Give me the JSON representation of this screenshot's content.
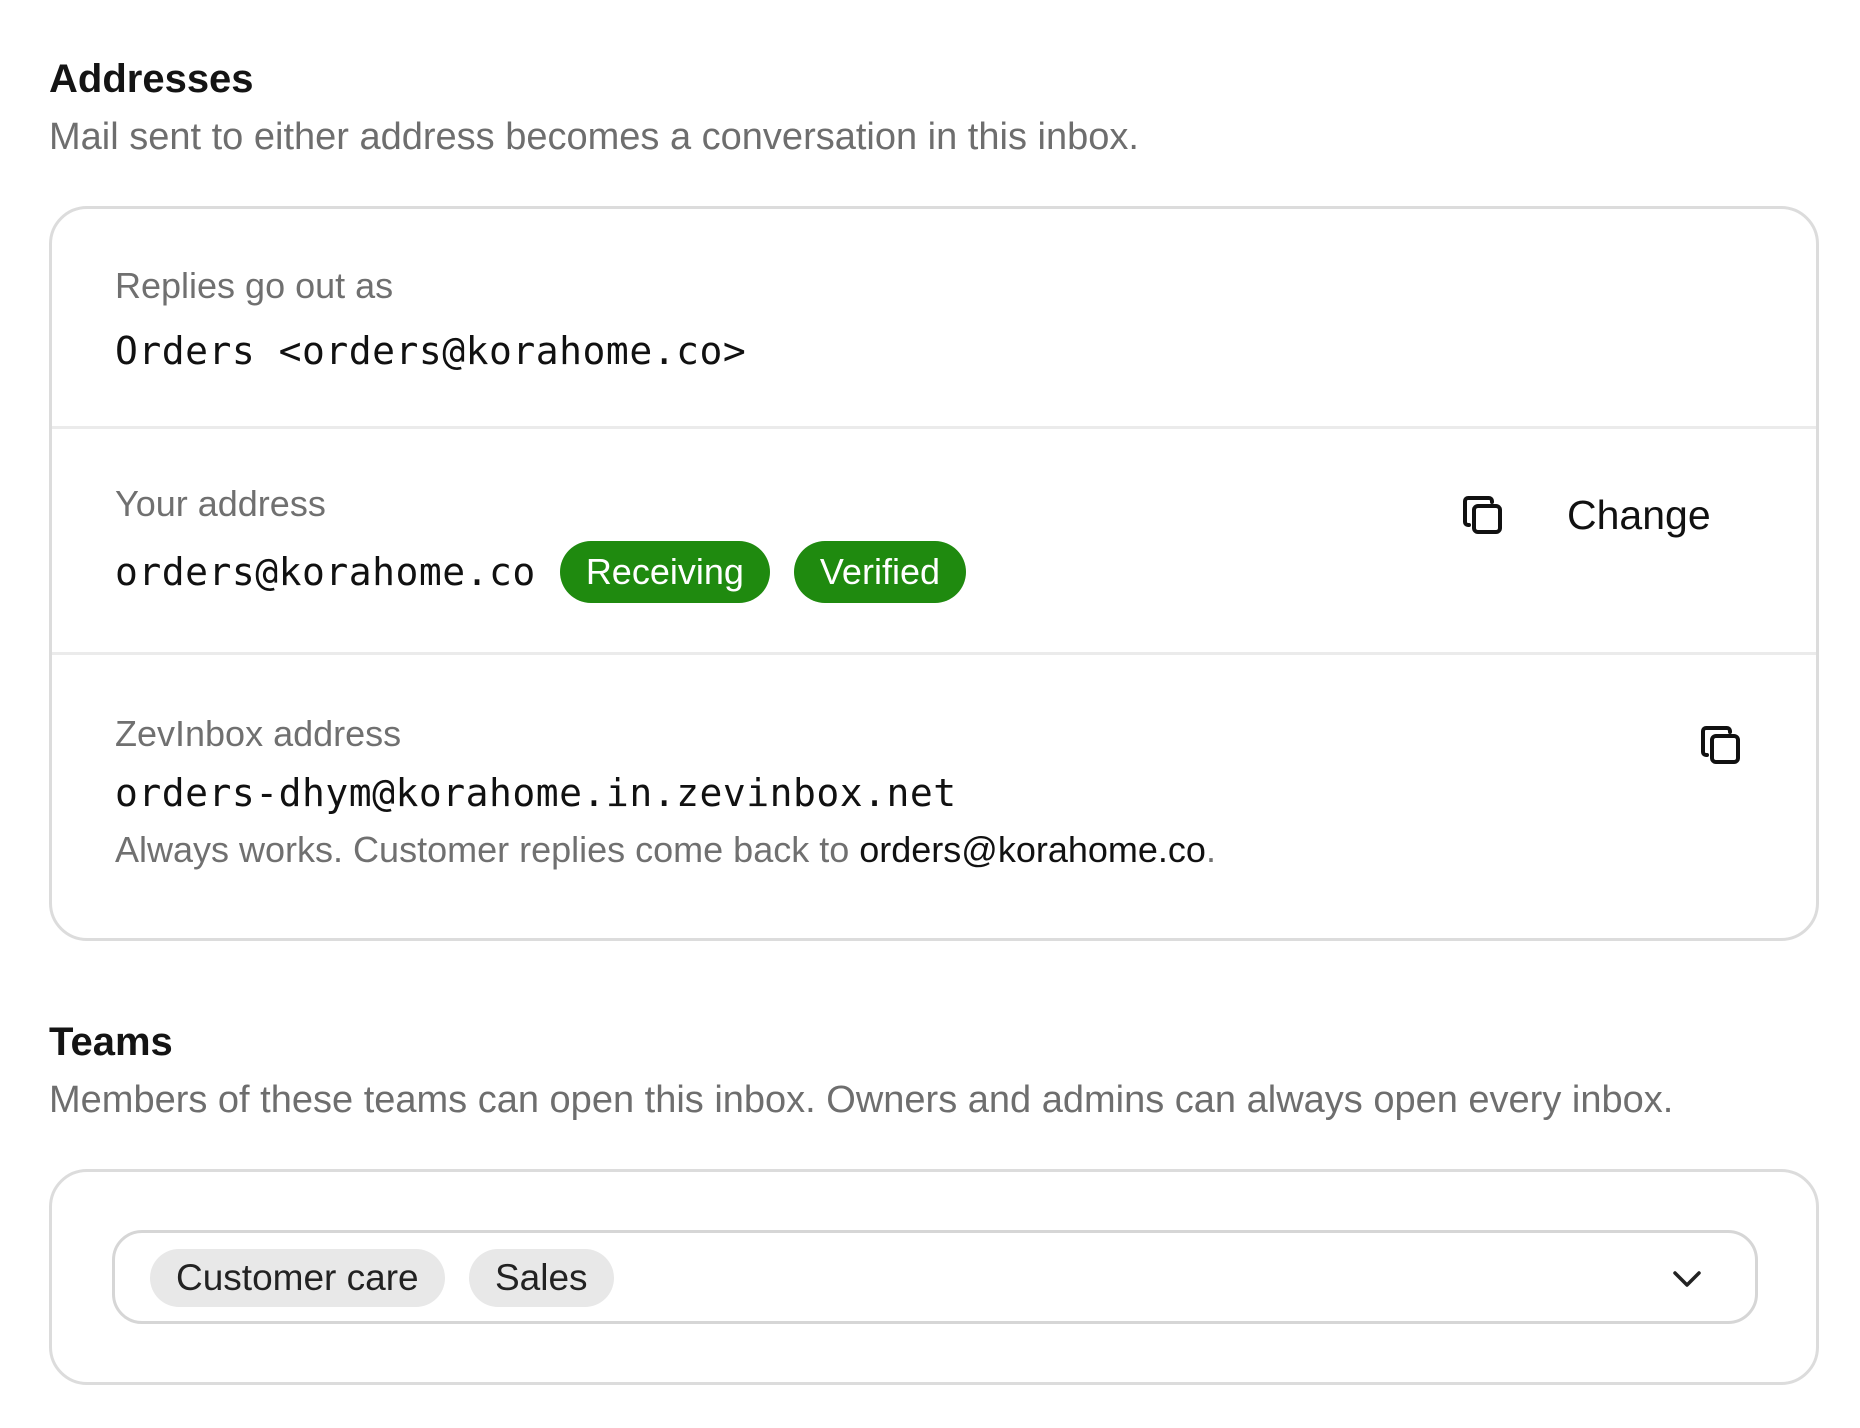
{
  "addresses": {
    "title": "Addresses",
    "description": "Mail sent to either address becomes a conversation in this inbox.",
    "replies_row": {
      "label": "Replies go out as",
      "value": "Orders <orders@korahome.co>"
    },
    "your_address_row": {
      "label": "Your address",
      "value": "orders@korahome.co",
      "badges": [
        {
          "label": "Receiving",
          "color": "#1f8a0f"
        },
        {
          "label": "Verified",
          "color": "#1f8a0f"
        }
      ],
      "copy_icon": "copy-icon",
      "change_label": "Change"
    },
    "zevinbox_row": {
      "label": "ZevInbox address",
      "value": "orders-dhym@korahome.in.zevinbox.net",
      "note_prefix": "Always works. Customer replies come back to ",
      "note_address": "orders@korahome.co",
      "note_suffix": ".",
      "copy_icon": "copy-icon"
    }
  },
  "teams": {
    "title": "Teams",
    "description": "Members of these teams can open this inbox. Owners and admins can always open every inbox.",
    "selected": [
      "Customer care",
      "Sales"
    ],
    "dropdown_icon": "chevron-down-icon"
  },
  "colors": {
    "badge_green": "#1f8a0f",
    "muted_text": "#707070",
    "border": "#dcdcdc",
    "chip_bg": "#e8e8e8"
  }
}
